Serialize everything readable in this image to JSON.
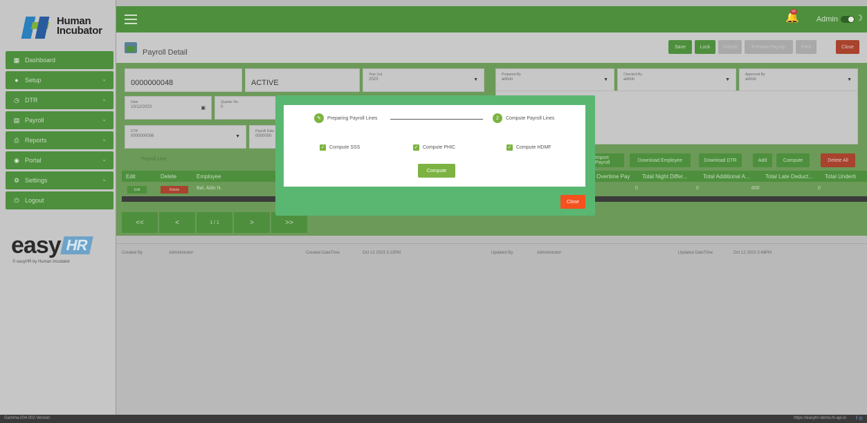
{
  "brand": {
    "logo_line1": "Human",
    "logo_line2": "Incubator",
    "easy": "easy",
    "hr": "HR",
    "powered": "© easyHR by Human Incubator"
  },
  "sidebar": {
    "items": [
      {
        "label": "Dashboard",
        "icon": "dashboard-icon"
      },
      {
        "label": "Setup",
        "icon": "setup-icon"
      },
      {
        "label": "DTR",
        "icon": "clock-icon"
      },
      {
        "label": "Payroll",
        "icon": "payroll-icon"
      },
      {
        "label": "Reports",
        "icon": "print-icon"
      },
      {
        "label": "Portal",
        "icon": "portal-icon"
      },
      {
        "label": "Settings",
        "icon": "gear-icon"
      },
      {
        "label": "Logout",
        "icon": "power-icon"
      }
    ]
  },
  "topbar": {
    "notif_count": "99",
    "user": "Admin"
  },
  "page": {
    "title": "Payroll Detail"
  },
  "toolbar": {
    "save": "Save",
    "lock": "Lock",
    "unlock": "Unlock",
    "preview": "Preview Payslip",
    "print": "Print",
    "close": "Close"
  },
  "form": {
    "payroll_no": "0000000048",
    "status": "ACTIVE",
    "year_label": "Year List",
    "year": "2023",
    "prepared_label": "Prepared By",
    "prepared": "admin",
    "checked_label": "Checked By",
    "checked": "admin",
    "approved_label": "Approved By",
    "approved": "admin",
    "date_label": "Date",
    "date": "10/12/2023",
    "quarter_label": "Quarter No.",
    "quarter": "0",
    "dtr_label": "DTR",
    "dtr": "0000000056",
    "payroll_date_label": "Payroll Date",
    "payroll_date": "0000000",
    "tab": "Payroll Line"
  },
  "actions": {
    "payroll": "Import Payroll",
    "download_emp": "Download Employee",
    "download_dtr": "Download DTR",
    "add": "Add",
    "compute": "Compute",
    "delete_all": "Delete All"
  },
  "table": {
    "headers": [
      "Edit",
      "Delete",
      "Employee",
      "Overtime Pay",
      "Total Night Differ...",
      "Total Additional A...",
      "Total Late Deduct...",
      "Total Underti"
    ],
    "row": {
      "edit": "Edit",
      "delete": "Delete",
      "employee": "Bal, Aldo N.",
      "overtime": "0",
      "night": "0",
      "additional": "600",
      "late": "0"
    }
  },
  "pager": {
    "first": "<<",
    "prev": "<",
    "page": "1 / 1",
    "next": ">",
    "last": ">>"
  },
  "audit": {
    "created_by_label": "Created By",
    "created_by": "Administrator",
    "created_dt_label": "Created DateTime",
    "created_dt": "Oct 12 2023 3:12PM",
    "updated_by_label": "Updated By",
    "updated_by": "Administrator",
    "updated_dt_label": "Updated DateTime",
    "updated_dt": "Oct 12 2023 3:48PM"
  },
  "footer": {
    "version": "Gamma.004.002 Version",
    "url": "https://easyhr-demo.hi-api.io"
  },
  "modal": {
    "step1": "Preparing Payroll Lines",
    "step2_num": "2",
    "step2": "Compute Payroll Lines",
    "check_sss": "Compute SSS",
    "check_phic": "Compute PHIC",
    "check_hdmf": "Compute HDMF",
    "compute": "Compute",
    "close": "Close"
  }
}
